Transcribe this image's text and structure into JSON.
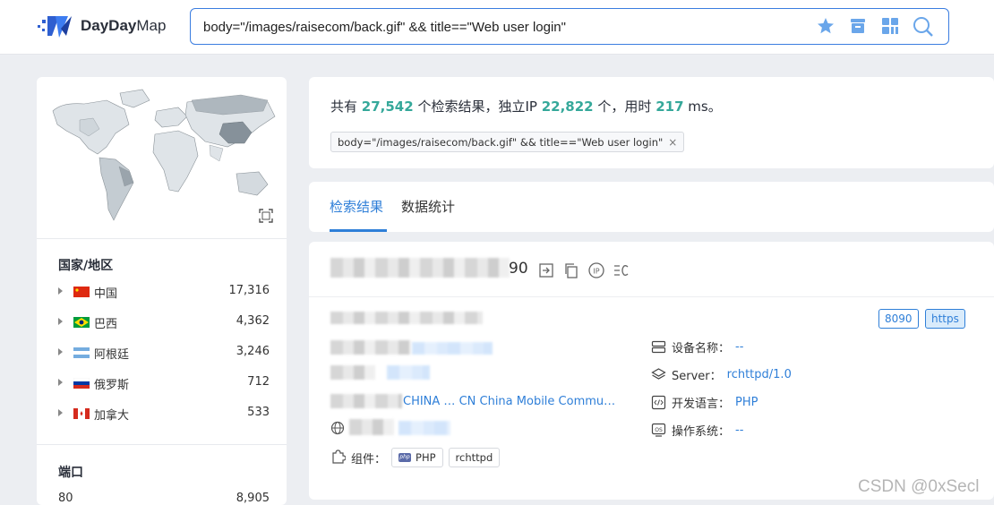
{
  "header": {
    "logo_text_bold": "DayDay",
    "logo_text_light": "Map",
    "search_query": "body=\"/images/raisecom/back.gif\" && title==\"Web user login\"",
    "icons": [
      "star-icon",
      "archive-icon",
      "grid-icon",
      "search-icon"
    ]
  },
  "sidebar": {
    "country_title": "国家/地区",
    "countries": [
      {
        "name": "中国",
        "count": "17,316",
        "flag": "cn"
      },
      {
        "name": "巴西",
        "count": "4,362",
        "flag": "br"
      },
      {
        "name": "阿根廷",
        "count": "3,246",
        "flag": "ar"
      },
      {
        "name": "俄罗斯",
        "count": "712",
        "flag": "ru"
      },
      {
        "name": "加拿大",
        "count": "533",
        "flag": "ca"
      }
    ],
    "port_title": "端口",
    "ports": [
      {
        "port": "80",
        "count": "8,905"
      }
    ]
  },
  "summary": {
    "prefix": "共有",
    "total": "27,542",
    "mid1": "个检索结果，独立IP",
    "unique_ip": "22,822",
    "mid2": "个，用时",
    "time": "217",
    "suffix": "ms。",
    "chip_label": "body=\"/images/raisecom/back.gif\" && title==\"Web user login\"",
    "chip_close": "×"
  },
  "tabs": [
    {
      "label": "检索结果",
      "active": true
    },
    {
      "label": "数据统计",
      "active": false
    }
  ],
  "result": {
    "title_tail": "90",
    "port_badge": "8090",
    "proto_badge": "https",
    "location_text": "CHINA … CN China Mobile Commu…",
    "device_label": "设备名称：",
    "device_value": "--",
    "server_label": "Server：",
    "server_value": "rchttpd/1.0",
    "lang_label": "开发语言：",
    "lang_value": "PHP",
    "os_label": "操作系统：",
    "os_value": "--",
    "component_label": "组件：",
    "components": [
      "PHP",
      "rchttpd"
    ]
  },
  "watermark": "CSDN @0xSecl",
  "colors": {
    "accent": "#2f7fd8",
    "count_green": "#35a89a"
  }
}
